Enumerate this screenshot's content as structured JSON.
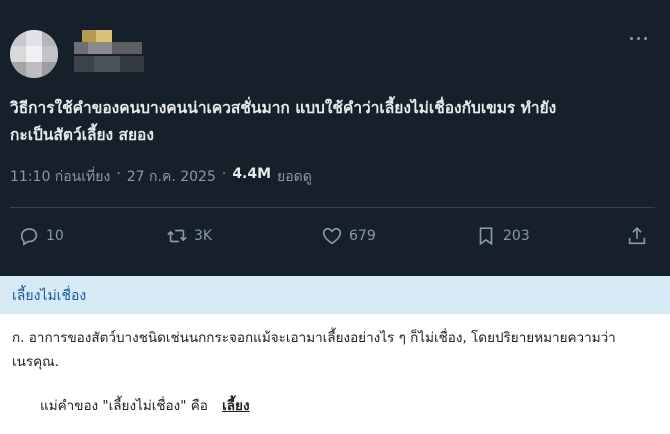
{
  "tweet": {
    "text": "วิธีการใช้คำของคนบางคนน่าเควสชั่นมาก แบบใช้คำว่าเลี้ยงไม่เชื่องกับเขมร ทำยัง\nกะเป็นสัตว์เลี้ยง สยอง",
    "time": "11:10 ก่อนเที่ยง",
    "date": "27 ก.ค. 2025",
    "views": "4.4M",
    "views_label": "ยอดดู",
    "separator": "·",
    "actions": {
      "reply": {
        "icon": "reply-icon",
        "count": "10"
      },
      "retweet": {
        "icon": "retweet-icon",
        "count": "3K"
      },
      "like": {
        "icon": "heart-icon",
        "count": "679"
      },
      "bookmark": {
        "icon": "bookmark-icon",
        "count": "203"
      },
      "share": {
        "icon": "share-icon"
      }
    }
  },
  "dictionary": {
    "title": "เลี้ยงไม่เชื่อง",
    "definition": "ก. อาการของสัตว์บางชนิดเช่นนกกระจอกแม้จะเอามาเลี้ยงอย่างไร ๆ ก็ไม่เชื่อง, โดยปริยายหมายความว่าเนรคุณ.",
    "reference_prefix": "แม่คำของ \"เลี้ยงไม่เชื่อง\" คือ",
    "reference_link": "เลี้ยง"
  },
  "colors": {
    "tweet_bg": "#15202b",
    "text_primary": "#e7e9ea",
    "text_secondary": "#8b98a5",
    "dict_header_bg": "#d6e9f5",
    "dict_title": "#1a5a96"
  }
}
